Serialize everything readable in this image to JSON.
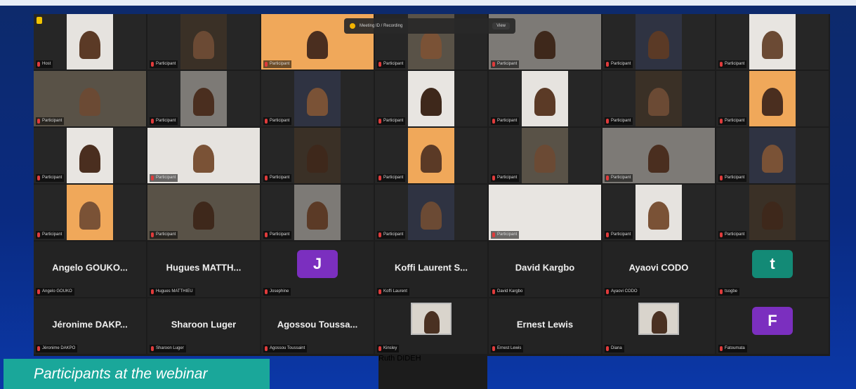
{
  "caption": "Participants at the webinar",
  "meeting_bar": {
    "label": "Meeting ID / Recording",
    "button": "View"
  },
  "row1": [
    {
      "name": "Host"
    },
    {
      "name": "Participant"
    },
    {
      "name": "Participant"
    },
    {
      "name": "Participant"
    },
    {
      "name": "Participant"
    },
    {
      "name": "Participant"
    },
    {
      "name": "Participant"
    }
  ],
  "row2": [
    {
      "name": "Participant"
    },
    {
      "name": "Participant"
    },
    {
      "name": "Participant"
    },
    {
      "name": "Participant"
    },
    {
      "name": "Participant"
    },
    {
      "name": "Participant"
    },
    {
      "name": "Participant"
    }
  ],
  "row3": [
    {
      "name": "Participant"
    },
    {
      "name": "Participant"
    },
    {
      "name": "Participant"
    },
    {
      "name": "Participant"
    },
    {
      "name": "Participant"
    },
    {
      "name": "Participant"
    },
    {
      "name": "Participant"
    }
  ],
  "row4": [
    {
      "name": "Participant"
    },
    {
      "name": "Participant"
    },
    {
      "name": "Participant"
    },
    {
      "name": "Participant"
    },
    {
      "name": "Participant"
    },
    {
      "name": "Participant"
    },
    {
      "name": "Participant"
    }
  ],
  "row5": [
    {
      "display": "Angelo GOUKO...",
      "name": "Angelo GOUKO"
    },
    {
      "display": "Hugues MATTH...",
      "name": "Hugues MATTHIEU"
    },
    {
      "avatar": "J",
      "name": "Josephine",
      "color": "#7b2fbf"
    },
    {
      "display": "Koffi Laurent S...",
      "name": "Koffi Laurent"
    },
    {
      "display": "David Kargbo",
      "name": "David Kargbo"
    },
    {
      "display": "Ayaovi CODO",
      "name": "Ayaovi CODO"
    },
    {
      "avatar": "t",
      "name": "tsogbe",
      "color": "#138a76"
    }
  ],
  "row6": [
    {
      "display": "Jéronime DAKP...",
      "name": "Jéronime DAKPO"
    },
    {
      "display": "Sharoon Luger",
      "name": "Sharoon Luger"
    },
    {
      "display": "Agossou Toussa...",
      "name": "Agossou Toussaint"
    },
    {
      "name": "Kinsley"
    },
    {
      "display": "Ernest Lewis",
      "name": "Ernest Lewis"
    },
    {
      "name": "Diana"
    },
    {
      "avatar": "F",
      "name": "Fatoumata",
      "color": "#7b2fbf"
    }
  ],
  "overflow": {
    "display": "Ruth DIDEH"
  },
  "colors": {
    "active_speaker": "#27b26a",
    "caption_bg": "#1aa79a"
  }
}
